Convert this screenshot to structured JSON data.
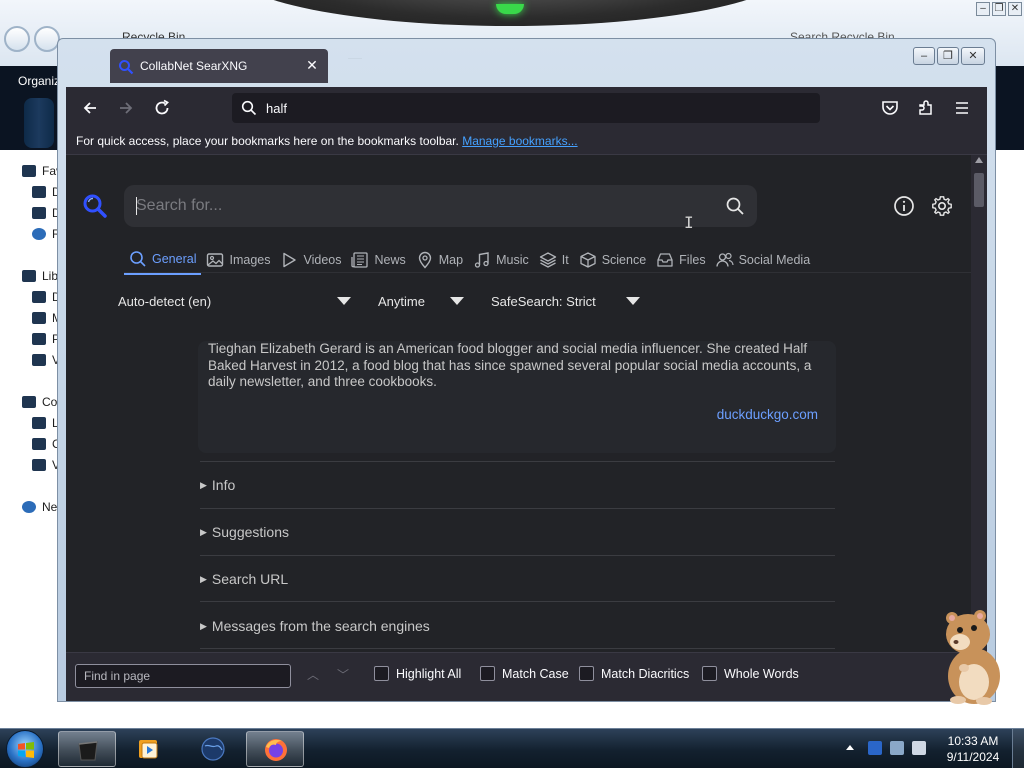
{
  "background_window": {
    "title": "Recycle Bin",
    "search_placeholder": "Search Recycle Bin",
    "organize_label": "Organiz",
    "nav": [
      {
        "label": "Fav",
        "icon": "star-icon"
      },
      {
        "label": "D",
        "icon": "desktop-icon"
      },
      {
        "label": "D",
        "icon": "downloads-icon"
      },
      {
        "label": "R",
        "icon": "recent-icon"
      },
      {
        "label": "Lib",
        "icon": "libraries-icon"
      },
      {
        "label": "D",
        "icon": "documents-icon"
      },
      {
        "label": "M",
        "icon": "music-icon"
      },
      {
        "label": "P",
        "icon": "pictures-icon"
      },
      {
        "label": "V",
        "icon": "videos-icon"
      },
      {
        "label": "Co",
        "icon": "computer-icon"
      },
      {
        "label": "L",
        "icon": "drive-icon"
      },
      {
        "label": "C",
        "icon": "drive-icon"
      },
      {
        "label": "V",
        "icon": "drive-icon"
      },
      {
        "label": "Ne",
        "icon": "network-icon"
      }
    ]
  },
  "browser": {
    "tab_title": "CollabNet SearXNG",
    "url_text": "half",
    "bookmarks_bar": {
      "text": "For quick access, place your bookmarks here on the bookmarks toolbar.",
      "link": "Manage bookmarks..."
    }
  },
  "searxng": {
    "search_placeholder": "Search for...",
    "categories": [
      {
        "label": "General",
        "icon": "search-icon",
        "active": true
      },
      {
        "label": "Images",
        "icon": "image-icon"
      },
      {
        "label": "Videos",
        "icon": "play-icon"
      },
      {
        "label": "News",
        "icon": "newspaper-icon"
      },
      {
        "label": "Map",
        "icon": "map-pin-icon"
      },
      {
        "label": "Music",
        "icon": "music-note-icon"
      },
      {
        "label": "It",
        "icon": "layers-icon"
      },
      {
        "label": "Science",
        "icon": "cube-icon"
      },
      {
        "label": "Files",
        "icon": "inbox-icon"
      },
      {
        "label": "Social Media",
        "icon": "people-icon"
      }
    ],
    "filters": {
      "language": "Auto-detect (en)",
      "time": "Anytime",
      "safesearch": "SafeSearch: Strict"
    },
    "infobox": {
      "text": "Tieghan Elizabeth Gerard is an American food blogger and social media influencer. She created Half Baked Harvest in 2012, a food blog that has since spawned several popular social media accounts, a daily newsletter, and three cookbooks.",
      "source": "duckduckgo.com"
    },
    "details": [
      "Info",
      "Suggestions",
      "Search URL",
      "Messages from the search engines"
    ]
  },
  "findbar": {
    "placeholder": "Find in page",
    "highlight_all": "Highlight All",
    "match_case": "Match Case",
    "match_diacritics": "Match Diacritics",
    "whole_words": "Whole Words"
  },
  "taskbar": {
    "time": "10:33 AM",
    "date": "9/11/2024"
  },
  "colors": {
    "accent": "#6c9fff",
    "page_bg": "#222327",
    "link": "#45a1ff"
  }
}
